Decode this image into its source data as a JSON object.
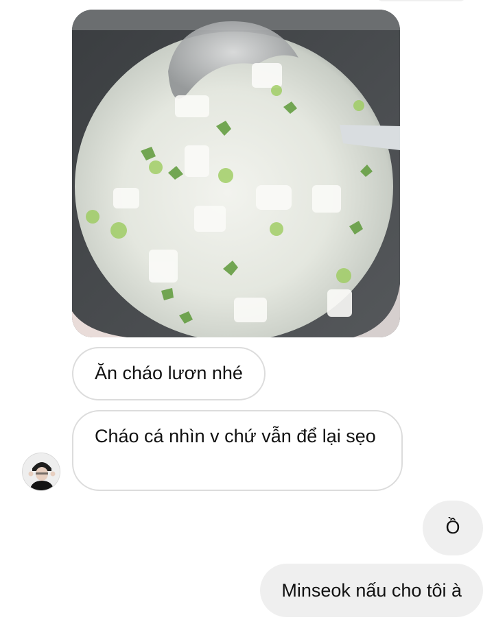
{
  "chat": {
    "messages": [
      {
        "sender": "other",
        "type": "image",
        "alt_icon": "photo-of-porridge"
      },
      {
        "sender": "other",
        "type": "text",
        "text": "Ăn cháo lươn nhé"
      },
      {
        "sender": "other",
        "type": "text",
        "text": "Cháo cá nhìn v chứ vẫn để lại sẹo"
      },
      {
        "sender": "me",
        "type": "text",
        "text": "Ồ"
      },
      {
        "sender": "me",
        "type": "text",
        "text": "Minseok nấu cho tôi à"
      }
    ]
  },
  "colors": {
    "incoming_border": "#dcdcdc",
    "outgoing_bg": "#efefef",
    "text": "#111111"
  }
}
